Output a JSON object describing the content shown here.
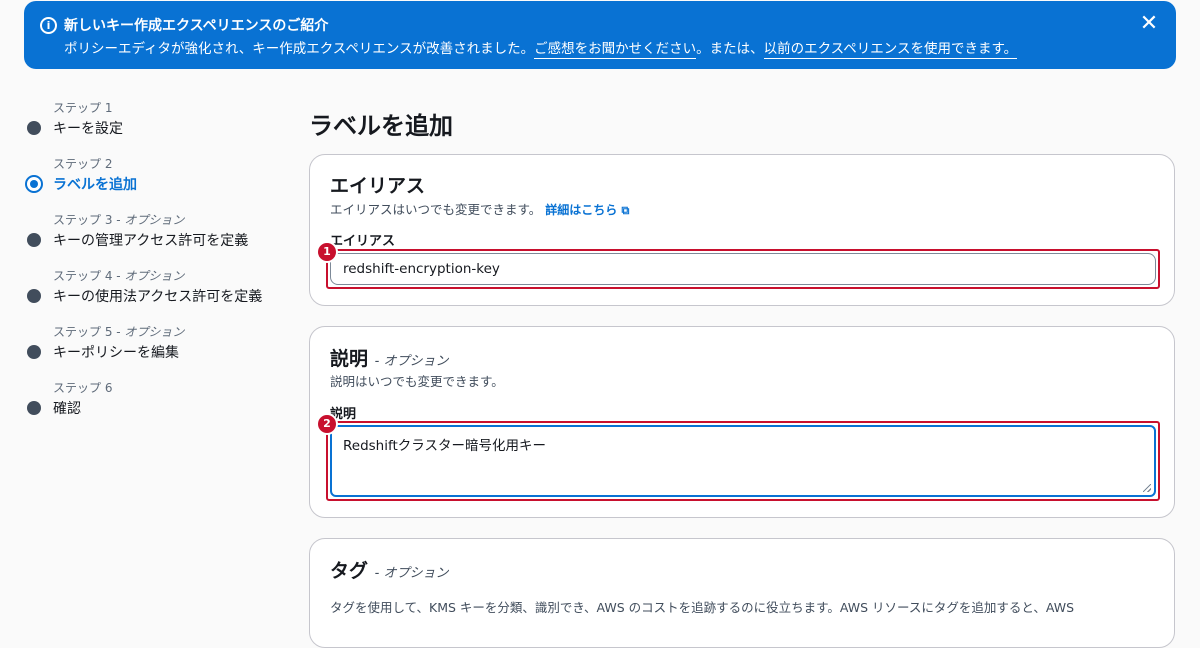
{
  "banner": {
    "title": "新しいキー作成エクスペリエンスのご紹介",
    "message": "ポリシーエディタが強化され、キー作成エクスペリエンスが改善されました。",
    "feedback_link": "ご感想をお聞かせください",
    "middle_text": "。または、",
    "previous_link": "以前のエクスペリエンスを使用できます。",
    "close_label": "✕"
  },
  "steps": [
    {
      "label": "ステップ 1",
      "optional": "",
      "name": "キーを設定"
    },
    {
      "label": "ステップ 2",
      "optional": "",
      "name": "ラベルを追加"
    },
    {
      "label": "ステップ 3 - ",
      "optional": "オプション",
      "name": "キーの管理アクセス許可を定義"
    },
    {
      "label": "ステップ 4 - ",
      "optional": "オプション",
      "name": "キーの使用法アクセス許可を定義"
    },
    {
      "label": "ステップ 5 - ",
      "optional": "オプション",
      "name": "キーポリシーを編集"
    },
    {
      "label": "ステップ 6",
      "optional": "",
      "name": "確認"
    }
  ],
  "active_step": 1,
  "page_title": "ラベルを追加",
  "alias_section": {
    "title": "エイリアス",
    "description": "エイリアスはいつでも変更できます。",
    "learn_more": "詳細はこちら",
    "field_label": "エイリアス",
    "value": "redshift-encryption-key",
    "badge": "1"
  },
  "description_section": {
    "title": "説明",
    "optional": "- オプション",
    "description": "説明はいつでも変更できます。",
    "field_label": "説明",
    "value": "Redshiftクラスター暗号化用キー",
    "badge": "2"
  },
  "tags_section": {
    "title": "タグ",
    "optional": "- オプション",
    "description": "タグを使用して、KMS キーを分類、識別でき、AWS のコストを追跡するのに役立ちます。AWS リソースにタグを追加すると、AWS"
  },
  "colors": {
    "accent": "#0972d3",
    "highlight": "#c8102e"
  }
}
